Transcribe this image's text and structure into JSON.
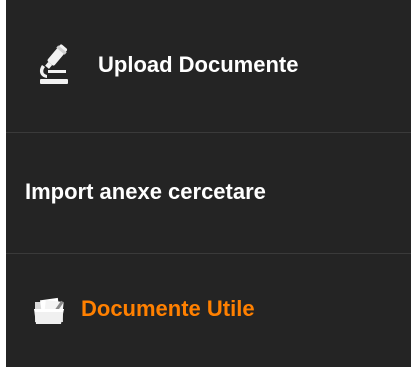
{
  "menu": {
    "items": [
      {
        "label": "Upload Documente",
        "icon": "microscope-icon",
        "color": "#ffffff"
      },
      {
        "label": "Import anexe cercetare",
        "color": "#ffffff"
      },
      {
        "label": "Documente Utile",
        "icon": "folder-icon",
        "color": "#ff8000",
        "active": true
      }
    ],
    "background": "#242424"
  }
}
